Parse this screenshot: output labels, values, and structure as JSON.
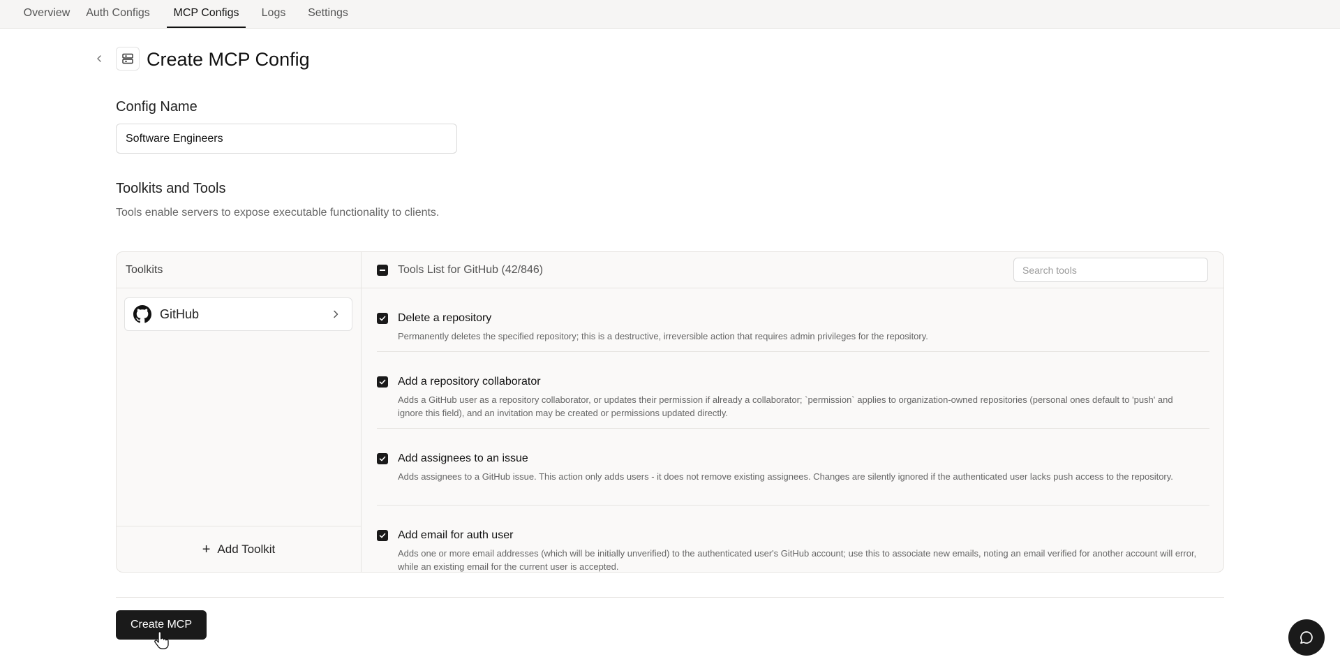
{
  "nav": {
    "tabs": [
      {
        "label": "Overview"
      },
      {
        "label": "Auth Configs"
      },
      {
        "label": "MCP Configs"
      },
      {
        "label": "Logs"
      },
      {
        "label": "Settings"
      }
    ],
    "active_tab": "MCP Configs"
  },
  "header": {
    "title": "Create MCP Config",
    "back_icon": "chevron-left-icon",
    "page_icon": "server-icon"
  },
  "config": {
    "label": "Config Name",
    "value": "Software Engineers"
  },
  "section": {
    "title": "Toolkits and Tools",
    "description": "Tools enable servers to expose executable functionality to clients."
  },
  "toolkits": {
    "heading": "Toolkits",
    "items": [
      {
        "name": "GitHub",
        "icon": "github-icon"
      }
    ],
    "add_label": "Add Toolkit"
  },
  "tools": {
    "heading": "Tools List for GitHub (42/846)",
    "search_placeholder": "Search tools",
    "items": [
      {
        "name": "Delete a repository",
        "description": "Permanently deletes the specified repository; this is a destructive, irreversible action that requires admin privileges for the repository.",
        "checked": true
      },
      {
        "name": "Add a repository collaborator",
        "description": "Adds a GitHub user as a repository collaborator, or updates their permission if already a collaborator; `permission` applies to organization-owned repositories (personal ones default to 'push' and ignore this field), and an invitation may be created or permissions updated directly.",
        "checked": true
      },
      {
        "name": "Add assignees to an issue",
        "description": "Adds assignees to a GitHub issue. This action only adds users - it does not remove existing assignees. Changes are silently ignored if the authenticated user lacks push access to the repository.",
        "checked": true
      },
      {
        "name": "Add email for auth user",
        "description": "Adds one or more email addresses (which will be initially unverified) to the authenticated user's GitHub account; use this to associate new emails, noting an email verified for another account will error, while an existing email for the current user is accepted.",
        "checked": true
      }
    ]
  },
  "actions": {
    "create_label": "Create MCP"
  },
  "chat": {
    "icon": "chat-bubble-icon"
  }
}
